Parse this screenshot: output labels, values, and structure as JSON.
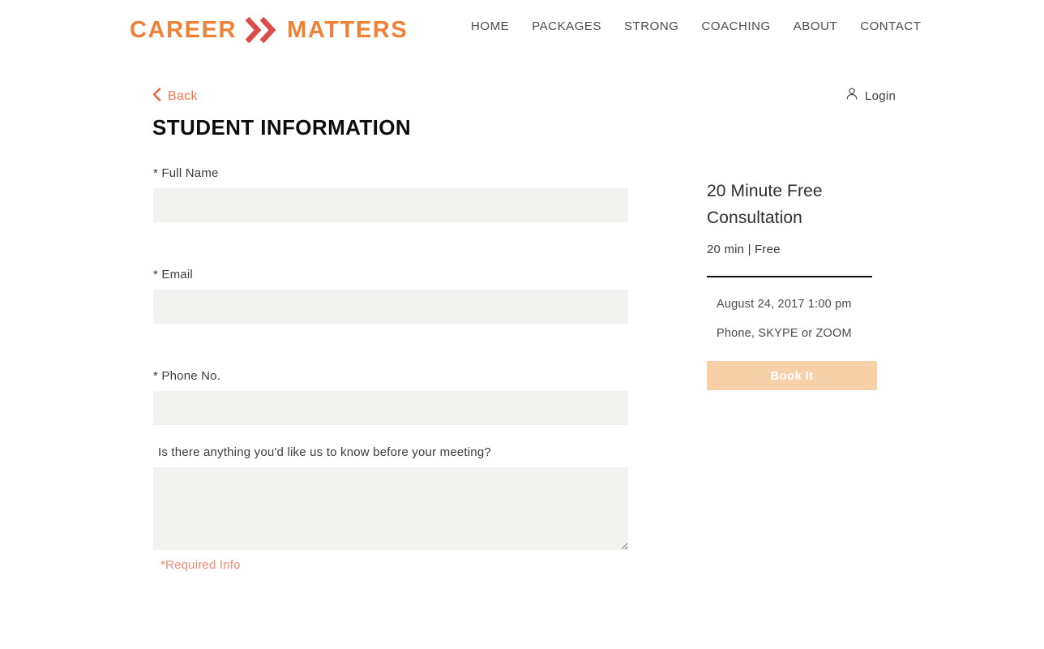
{
  "header": {
    "logo": {
      "word_one": "CAREER",
      "word_two": "MATTERS",
      "chevron_color": "#dc4a4a",
      "word_color": "#ef8136"
    },
    "nav": [
      {
        "label": "HOME"
      },
      {
        "label": "PACKAGES"
      },
      {
        "label": "STRONG"
      },
      {
        "label": "COACHING"
      },
      {
        "label": "ABOUT"
      },
      {
        "label": "CONTACT"
      }
    ]
  },
  "toolbar": {
    "back_label": "Back",
    "back_icon": "chevron-left-icon",
    "back_color": "#ef7b4f",
    "login_label": "Login",
    "login_icon": "user-icon"
  },
  "main": {
    "title": "STUDENT INFORMATION",
    "fields": [
      {
        "label": "* Full Name",
        "required": true,
        "value": "",
        "placeholder": "",
        "type": "text",
        "name": "full-name"
      },
      {
        "label": "* Email",
        "required": true,
        "value": "",
        "placeholder": "",
        "type": "text",
        "name": "email"
      },
      {
        "label": "* Phone No.",
        "required": true,
        "value": "",
        "placeholder": "",
        "type": "text",
        "name": "phone"
      },
      {
        "label": "Is there anything you'd like us to know before your meeting?",
        "required": false,
        "value": "",
        "placeholder": "",
        "type": "textarea",
        "name": "message"
      }
    ],
    "required_note": "*Required Info",
    "required_note_color": "#ef8a78",
    "input_background": "#f2f2f0"
  },
  "booking": {
    "title": "20 Minute Free Consultation",
    "meta": "20 min  |  Free",
    "date_time": "August 24, 2017 1:00 pm",
    "location": "Phone, SKYPE or ZOOM",
    "book_label": "Book It",
    "book_button_color": "#f7d0a8"
  }
}
